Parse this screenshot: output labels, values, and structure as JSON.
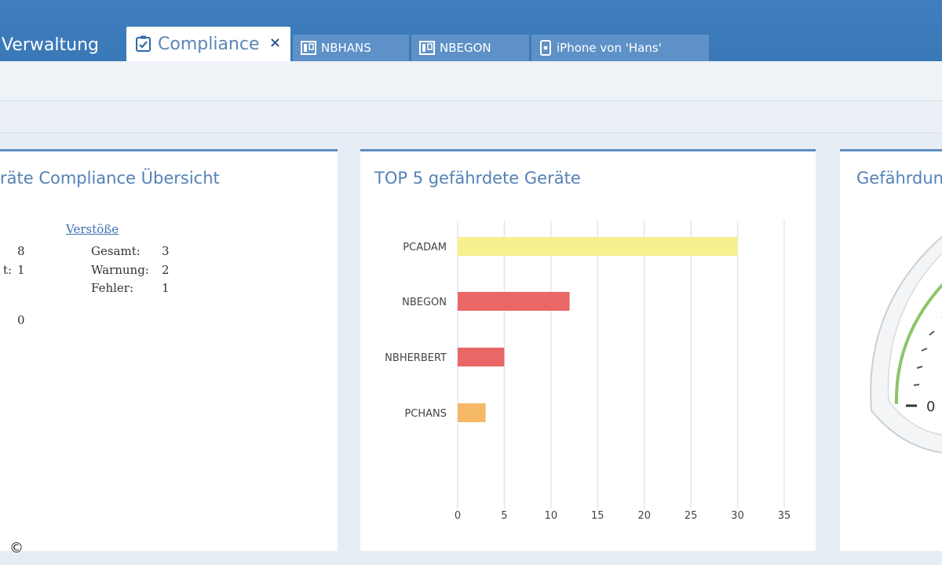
{
  "tabs": {
    "verwaltung": "Verwaltung",
    "compliance": "Compliance",
    "compliance_close": "×",
    "nbhans": "NBHANS",
    "nbegon": "NBEGON",
    "iphone": "iPhone von 'Hans'"
  },
  "overview": {
    "title": "räte Compliance Übersicht",
    "left_values": {
      "row1_label": "",
      "row1_value": "8",
      "row2_label": "t:",
      "row2_value": "1",
      "row4_value": "0"
    },
    "verstoesse": {
      "link": "Verstöße",
      "gesamt_label": "Gesamt:",
      "gesamt_value": "3",
      "warnung_label": "Warnung:",
      "warnung_value": "2",
      "fehler_label": "Fehler:",
      "fehler_value": "1"
    }
  },
  "top5": {
    "title": "TOP 5 gefährdete Geräte"
  },
  "chart_data": {
    "type": "bar",
    "orientation": "horizontal",
    "categories": [
      "PCADAM",
      "NBEGON",
      "NBHERBERT",
      "PCHANS"
    ],
    "values": [
      30,
      12,
      5,
      3
    ],
    "colors": [
      "#f7f08f",
      "#e96866",
      "#e96866",
      "#f4b866"
    ],
    "xlim": [
      0,
      35
    ],
    "xticks": [
      0,
      5,
      10,
      15,
      20,
      25,
      30,
      35
    ],
    "grid": true
  },
  "gauge": {
    "title": "Gefährdun",
    "zero_label": "0"
  },
  "copyright": "©",
  "colors": {
    "accent": "#3a78b7",
    "panel_border": "#5c8fc3",
    "title_blue": "#5581b6"
  }
}
